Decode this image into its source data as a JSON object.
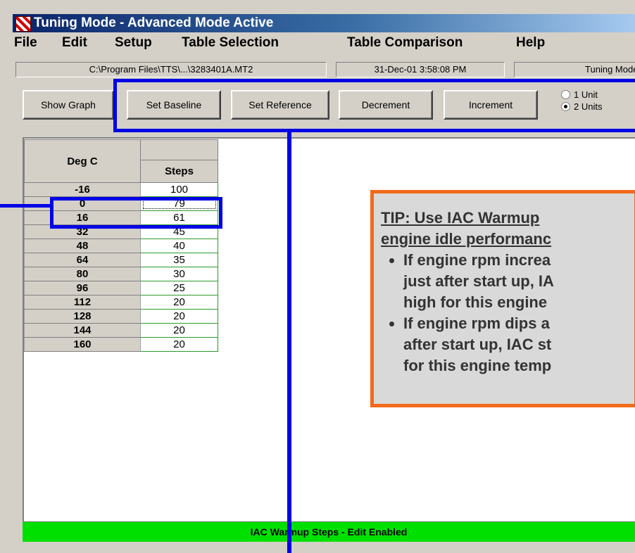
{
  "window": {
    "title": "Tuning Mode - Advanced Mode Active"
  },
  "menu": [
    {
      "label": "File"
    },
    {
      "label": "Edit"
    },
    {
      "label": "Setup"
    },
    {
      "label": "Table Selection"
    },
    {
      "label": "Table Comparison"
    },
    {
      "label": "Help"
    }
  ],
  "status_fields": {
    "file_path": "C:\\Program Files\\TTS\\...\\3283401A.MT2",
    "datetime": "31-Dec-01 3:58:08 PM",
    "mode": "Tuning Mode File"
  },
  "toolbar": {
    "show_graph": "Show Graph",
    "set_baseline": "Set Baseline",
    "set_reference": "Set Reference",
    "decrement": "Decrement",
    "increment": "Increment",
    "radio_options": [
      {
        "label": "1 Unit",
        "selected": false
      },
      {
        "label": "2 Units",
        "selected": true
      }
    ]
  },
  "table": {
    "headers": [
      "Deg C",
      "Steps"
    ],
    "rows": [
      {
        "deg": "-16",
        "steps": "100"
      },
      {
        "deg": "0",
        "steps": "79",
        "selected": true
      },
      {
        "deg": "16",
        "steps": "61"
      },
      {
        "deg": "32",
        "steps": "45"
      },
      {
        "deg": "48",
        "steps": "40"
      },
      {
        "deg": "64",
        "steps": "35"
      },
      {
        "deg": "80",
        "steps": "30"
      },
      {
        "deg": "96",
        "steps": "25"
      },
      {
        "deg": "112",
        "steps": "20"
      },
      {
        "deg": "128",
        "steps": "20"
      },
      {
        "deg": "144",
        "steps": "20"
      },
      {
        "deg": "160",
        "steps": "20"
      }
    ]
  },
  "tip": {
    "heading": "TIP:  Use IAC Warmup\nengine idle performanc",
    "bullets": [
      "If engine rpm increa\njust after start up, IA\nhigh for this engine",
      "If engine rpm dips a\nafter start up, IAC st\nfor this engine temp"
    ]
  },
  "status_bar": {
    "text": "IAC Warmup Steps - Edit Enabled"
  },
  "colors": {
    "status_bar_bg": "#00e000",
    "highlight_blue": "#0000e6",
    "tip_border": "#f26a1b",
    "title_bar": "#0a246a"
  }
}
